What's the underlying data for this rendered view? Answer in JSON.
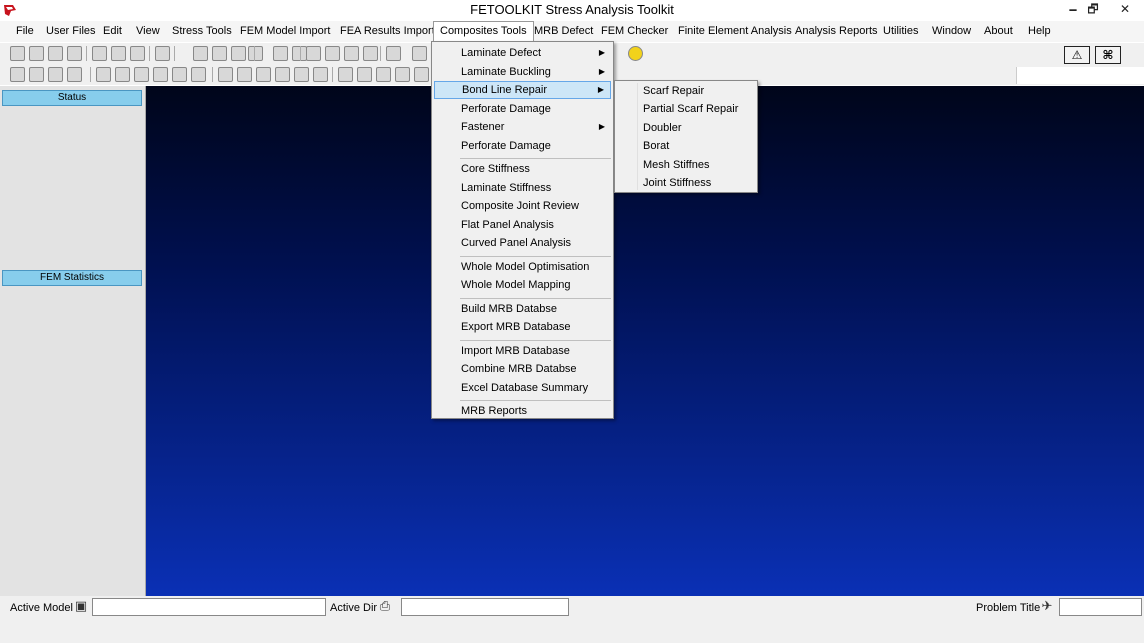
{
  "window": {
    "title": "FETOOLKIT Stress Analysis Toolkit",
    "min_glyph": "🗕",
    "max_glyph": "🗗",
    "close_glyph": "✕"
  },
  "menubar": {
    "items": [
      {
        "label": "File"
      },
      {
        "label": "User Files"
      },
      {
        "label": "Edit"
      },
      {
        "label": "View"
      },
      {
        "label": "Stress Tools"
      },
      {
        "label": "FEM Model Import"
      },
      {
        "label": "FEA Results Import"
      },
      {
        "label": "Composites Tools",
        "active": true
      },
      {
        "label": "MRB Defect"
      },
      {
        "label": "FEM  Checker"
      },
      {
        "label": "Finite Element Analysis"
      },
      {
        "label": "Analysis Reports"
      },
      {
        "label": "Utilities"
      },
      {
        "label": "Window"
      },
      {
        "label": "About"
      },
      {
        "label": "Help"
      }
    ]
  },
  "toolbar": {
    "right_buttons": [
      {
        "name": "warning-tool-icon",
        "glyph": "⚠"
      },
      {
        "name": "binoculars-icon",
        "glyph": "⌘"
      }
    ]
  },
  "side_panel": {
    "status_label": "Status",
    "fem_stats_label": "FEM Statistics"
  },
  "composites_menu": {
    "items": [
      {
        "label": "Laminate Defect",
        "submenu": true
      },
      {
        "label": "Laminate Buckling",
        "submenu": true
      },
      {
        "label": "Bond Line Repair",
        "submenu": true,
        "highlight": true
      },
      {
        "label": "Perforate Damage"
      },
      {
        "label": "Fastener",
        "submenu": true
      },
      {
        "label": "Perforate Damage"
      },
      {
        "separator": true
      },
      {
        "label": "Core Stiffness"
      },
      {
        "label": "Laminate Stiffness"
      },
      {
        "label": "Composite Joint Review"
      },
      {
        "label": "Flat Panel Analysis"
      },
      {
        "label": "Curved Panel Analysis"
      },
      {
        "separator": true
      },
      {
        "label": "Whole Model Optimisation"
      },
      {
        "label": "Whole Model Mapping"
      },
      {
        "separator": true
      },
      {
        "label": "Build MRB Databse"
      },
      {
        "label": "Export MRB Database"
      },
      {
        "separator": true
      },
      {
        "label": "Import MRB Database"
      },
      {
        "label": "Combine MRB Databse"
      },
      {
        "label": "Excel Database Summary"
      },
      {
        "separator": true
      },
      {
        "label": "MRB Reports"
      }
    ],
    "arrow_glyph": "▶"
  },
  "bond_line_submenu": {
    "items": [
      {
        "label": "Scarf Repair"
      },
      {
        "label": "Partial Scarf Repair"
      },
      {
        "label": "Doubler"
      },
      {
        "label": "Borat"
      },
      {
        "label": "Mesh Stiffnes"
      },
      {
        "label": "Joint Stiffness"
      }
    ]
  },
  "statusbar": {
    "active_model_label": "Active Model",
    "active_model_value": "",
    "active_dir_label": "Active Dir",
    "active_dir_value": "",
    "problem_title_label": "Problem Title",
    "problem_title_value": ""
  }
}
